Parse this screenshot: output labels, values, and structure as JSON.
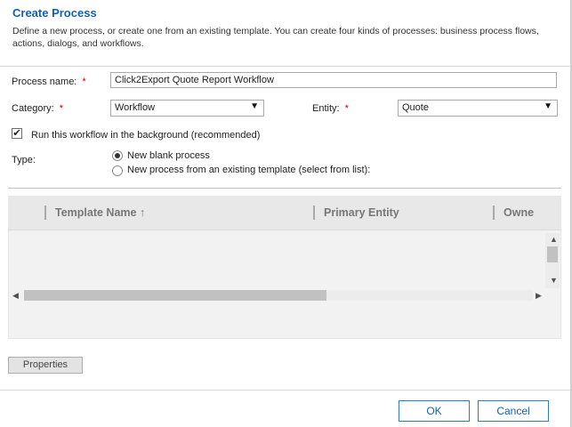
{
  "dialog": {
    "title": "Create Process",
    "description": "Define a new process, or create one from an existing template. You can create four kinds of processes: business process flows, actions, dialogs, and workflows."
  },
  "form": {
    "process_name_label": "Process name:",
    "process_name_value": "Click2Export Quote Report Workflow",
    "required_marker": "*",
    "category_label": "Category:",
    "category_value": "Workflow",
    "entity_label": "Entity:",
    "entity_value": "Quote",
    "background_checkbox_label": "Run this workflow in the background (recommended)",
    "background_checked": true,
    "type_label": "Type:",
    "type_options": [
      "New blank process",
      "New process from an existing template (select from list):"
    ],
    "type_selected_index": 0
  },
  "grid": {
    "columns": [
      "Template Name ↑",
      "Primary Entity",
      "Owne"
    ]
  },
  "buttons": {
    "properties": "Properties",
    "ok": "OK",
    "cancel": "Cancel"
  },
  "icons": {
    "dropdown": "caret-down-icon",
    "sort_ascending": "arrow-up-icon",
    "scroll_up": "triangle-up-icon",
    "scroll_down": "triangle-down-icon",
    "scroll_left": "triangle-left-icon",
    "scroll_right": "triangle-right-icon",
    "checkbox_check": "check-icon"
  },
  "colors": {
    "title_blue": "#1160b7",
    "required_red": "#d00000",
    "button_border": "#2b7ac9"
  }
}
